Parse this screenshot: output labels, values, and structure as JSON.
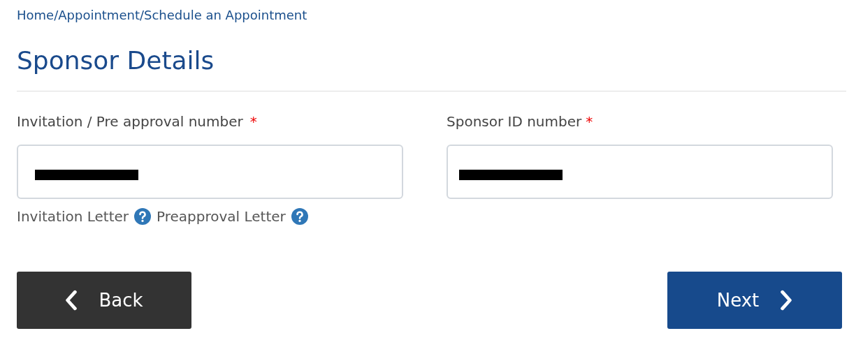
{
  "breadcrumb": "Home/Appointment/Schedule an Appointment",
  "title": "Sponsor Details",
  "fields": [
    {
      "label": "Invitation / Pre approval number",
      "required_mark": "*",
      "redacted": true,
      "links": [
        "Invitation Letter",
        "Preapproval Letter"
      ]
    },
    {
      "label": "Sponsor ID number",
      "required_mark": "*",
      "redacted": true
    }
  ],
  "buttons": [
    {
      "label": "Back",
      "kind": "back"
    },
    {
      "label": "Next",
      "kind": "next"
    }
  ]
}
